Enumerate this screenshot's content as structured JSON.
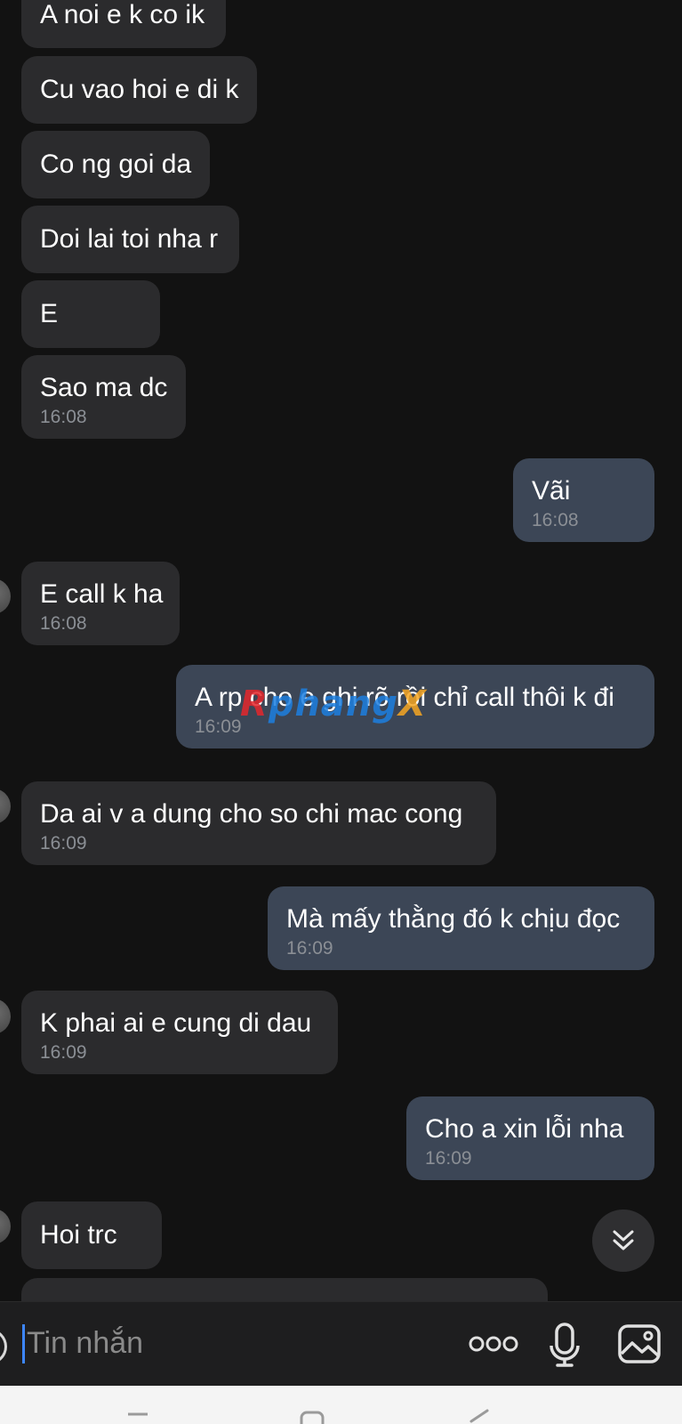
{
  "messages": [
    {
      "dir": "in",
      "text": "A noi e k co ik",
      "time": ""
    },
    {
      "dir": "in",
      "text": "Cu vao hoi e di k",
      "time": ""
    },
    {
      "dir": "in",
      "text": "Co ng goi da",
      "time": ""
    },
    {
      "dir": "in",
      "text": "Doi lai toi nha r",
      "time": ""
    },
    {
      "dir": "in",
      "text": "E",
      "time": ""
    },
    {
      "dir": "in",
      "text": "Sao ma dc",
      "time": "16:08"
    },
    {
      "dir": "out",
      "text": "Vãi",
      "time": "16:08"
    },
    {
      "dir": "in",
      "text": "E call k ha",
      "time": "16:08"
    },
    {
      "dir": "out",
      "text": "A rp cho e ghi rõ rồi chỉ call thôi k đi",
      "time": "16:09"
    },
    {
      "dir": "in",
      "text": "Da ai v a dung cho so chi mac cong",
      "time": "16:09"
    },
    {
      "dir": "out",
      "text": "Mà mấy thằng đó k chịu đọc",
      "time": "16:09"
    },
    {
      "dir": "in",
      "text": "K phai ai e cung di dau",
      "time": "16:09"
    },
    {
      "dir": "out",
      "text": "Cho a xin lỗi nha",
      "time": "16:09"
    },
    {
      "dir": "in",
      "text": "Hoi trc",
      "time": ""
    }
  ],
  "watermark": {
    "p1": "R",
    "p2": "phang",
    "p3": "X"
  },
  "composer": {
    "placeholder": "Tin nhắn",
    "more_icon": "more-dots-icon",
    "mic_icon": "microphone-icon",
    "image_icon": "image-gallery-icon"
  },
  "colors": {
    "background": "#121212",
    "incoming_bubble": "#2b2b2d",
    "outgoing_bubble": "#3c4656",
    "timestamp": "#8b8f95",
    "caret": "#3d86ff"
  }
}
